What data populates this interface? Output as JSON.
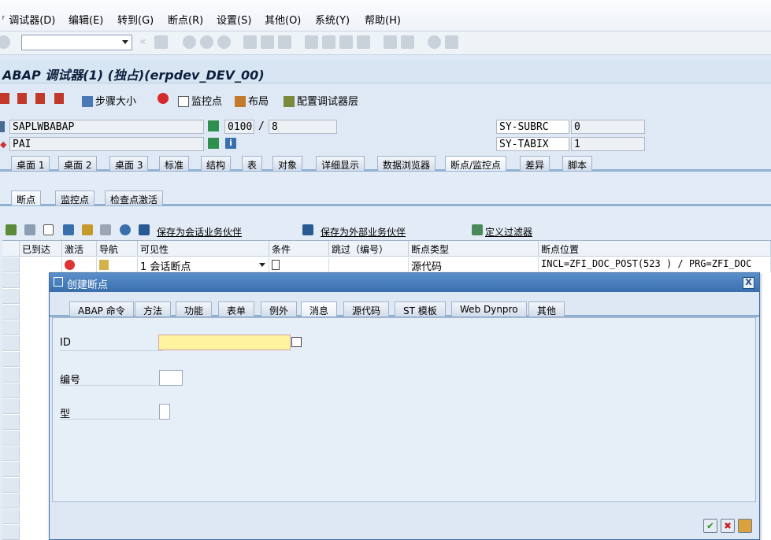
{
  "menu": {
    "items": [
      "调试器(D)",
      "编辑(E)",
      "转到(G)",
      "断点(R)",
      "设置(S)",
      "其他(O)",
      "系统(Y)",
      "帮助(H)"
    ]
  },
  "window": {
    "title": "ABAP 调试器(1)  (独占)(erpdev_DEV_00)"
  },
  "app_toolbar": {
    "step_size": "步骤大小",
    "watchpoint": "监控点",
    "layout": "布局",
    "config_layers": "配置调试器层"
  },
  "info": {
    "program": "SAPLWBABAP",
    "screen": "0100",
    "slash": "/",
    "line": "8",
    "event": "PAI",
    "subrc_label": "SY-SUBRC",
    "subrc_value": "0",
    "tabix_label": "SY-TABIX",
    "tabix_value": "1"
  },
  "main_tabs": [
    "桌面 1",
    "桌面 2",
    "桌面 3",
    "标准",
    "结构",
    "表",
    "对象",
    "详细显示",
    "数据浏览器",
    "断点/监控点",
    "差异",
    "脚本"
  ],
  "main_tab_selected": "断点/监控点",
  "sub_tabs": [
    "断点",
    "监控点",
    "检查点激活"
  ],
  "grid_toolbar": {
    "save_session": "保存为会话业务伙伴",
    "save_external": "保存为外部业务伙伴",
    "define_filter": "定义过滤器"
  },
  "grid": {
    "columns": [
      "已到达",
      "激活",
      "导航",
      "可见性",
      "条件",
      "跳过（编号）",
      "断点类型",
      "断点位置"
    ],
    "rows": [
      {
        "visibility": "1 会话断点",
        "type": "源代码",
        "position": "INCL=ZFI_DOC_POST(523 ) / PRG=ZFI_DOC"
      }
    ]
  },
  "dialog": {
    "title": "创建断点",
    "close": "X",
    "tabs": [
      "ABAP 命令",
      "方法",
      "功能",
      "表单",
      "例外",
      "消息",
      "源代码",
      "ST 模板",
      "Web Dynpro",
      "其他"
    ],
    "selected_tab": "消息",
    "fields": {
      "id_label": "ID",
      "id_value": "",
      "number_label": "编号",
      "number_value": "",
      "type_label": "型",
      "type_value": ""
    }
  },
  "colors": {
    "accent": "#3a6fae",
    "input_required": "#fff3a0"
  }
}
